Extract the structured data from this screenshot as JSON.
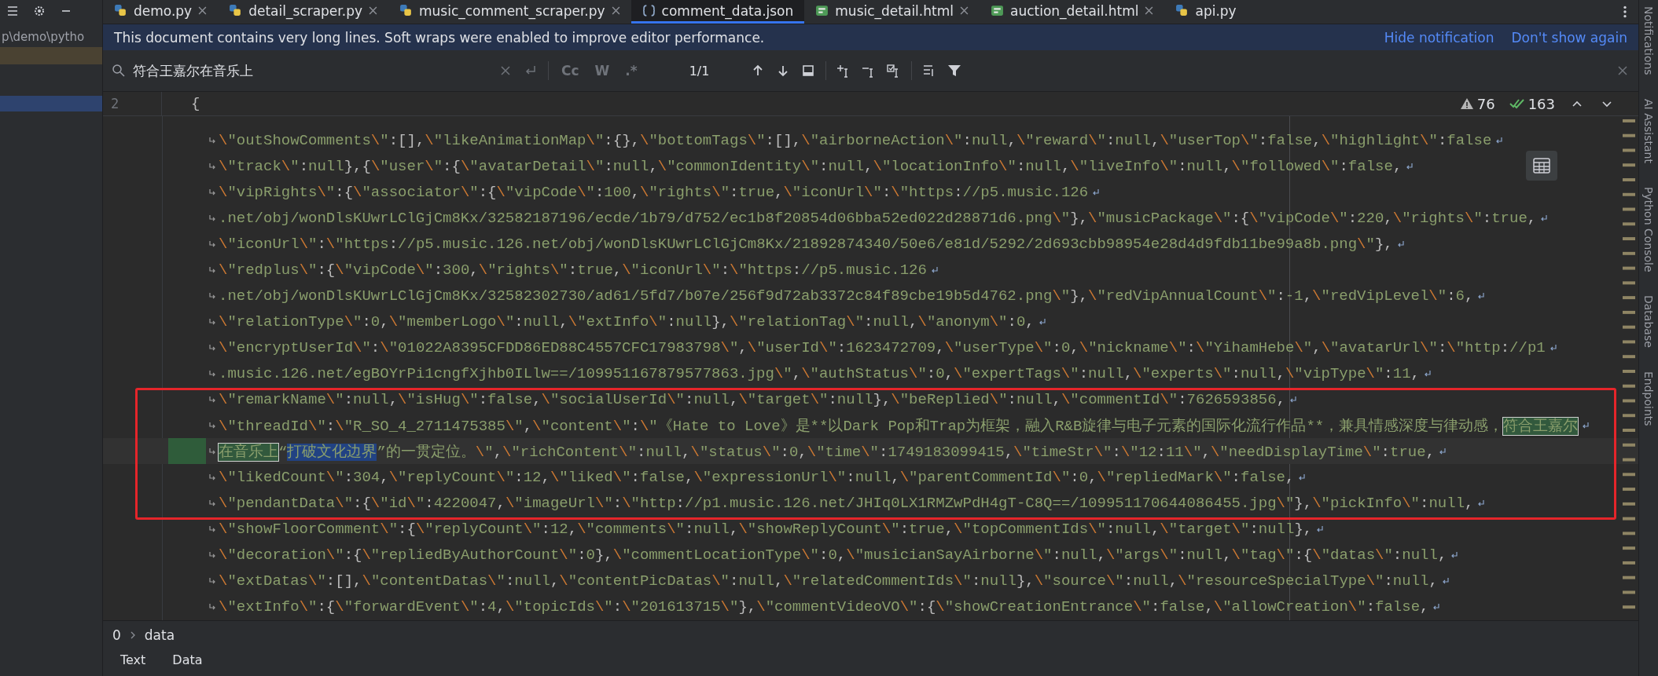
{
  "project_panel": {
    "path": "p\\demo\\pytho"
  },
  "tabs": [
    {
      "label": "demo.py",
      "kind": "py",
      "selected": false,
      "closable": true
    },
    {
      "label": "detail_scraper.py",
      "kind": "py",
      "selected": false,
      "closable": true
    },
    {
      "label": "music_comment_scraper.py",
      "kind": "py",
      "selected": false,
      "closable": true
    },
    {
      "label": "comment_data.json",
      "kind": "json",
      "selected": true,
      "closable": false
    },
    {
      "label": "music_detail.html",
      "kind": "html",
      "selected": false,
      "closable": true
    },
    {
      "label": "auction_detail.html",
      "kind": "html",
      "selected": false,
      "closable": true
    },
    {
      "label": "api.py",
      "kind": "py",
      "selected": false,
      "closable": false
    }
  ],
  "notification": {
    "text": "This document contains very long lines. Soft wraps were enabled to improve editor performance.",
    "actions": [
      "Hide notification",
      "Don't show again"
    ]
  },
  "search": {
    "value": "符合王嘉尔在音乐上",
    "options": [
      "Cc",
      "W",
      ".*"
    ],
    "match_count": "1/1"
  },
  "editor": {
    "header_line_number": "2",
    "header_text": "{",
    "warnings": "76",
    "checks": "163",
    "lines": [
      {
        "current": false,
        "text": "\\\"outShowComments\\\":[],\\\"likeAnimationMap\\\":{},\\\"bottomTags\\\":[],\\\"airborneAction\\\":null,\\\"reward\\\":null,\\\"userTop\\\":false,\\\"highlight\\\":false"
      },
      {
        "current": false,
        "text": "\\\"track\\\":null},{\\\"user\\\":{\\\"avatarDetail\\\":null,\\\"commonIdentity\\\":null,\\\"locationInfo\\\":null,\\\"liveInfo\\\":null,\\\"followed\\\":false,"
      },
      {
        "current": false,
        "text": "\\\"vipRights\\\":{\\\"associator\\\":{\\\"vipCode\\\":100,\\\"rights\\\":true,\\\"iconUrl\\\":\\\"https://p5.music.126"
      },
      {
        "current": false,
        "text": ".net/obj/wonDlsKUwrLClGjCm8Kx/32582187196/ecde/1b79/d752/ec1b8f20854d06bba52ed022d28871d6.png\\\"},\\\"musicPackage\\\":{\\\"vipCode\\\":220,\\\"rights\\\":true,"
      },
      {
        "current": false,
        "text": "\\\"iconUrl\\\":\\\"https://p5.music.126.net/obj/wonDlsKUwrLClGjCm8Kx/21892874340/50e6/e81d/5292/2d693cbb98954e28d4d9fdb11be99a8b.png\\\"},"
      },
      {
        "current": false,
        "text": "\\\"redplus\\\":{\\\"vipCode\\\":300,\\\"rights\\\":true,\\\"iconUrl\\\":\\\"https://p5.music.126"
      },
      {
        "current": false,
        "text": ".net/obj/wonDlsKUwrLClGjCm8Kx/32582302730/ad61/5fd7/b07e/256f9d72ab3372c84f89cbe19b5d4762.png\\\"},\\\"redVipAnnualCount\\\":-1,\\\"redVipLevel\\\":6,"
      },
      {
        "current": false,
        "text": "\\\"relationType\\\":0,\\\"memberLogo\\\":null,\\\"extInfo\\\":null},\\\"relationTag\\\":null,\\\"anonym\\\":0,"
      },
      {
        "current": false,
        "text": "\\\"encryptUserId\\\":\\\"01022A8395CFDD86ED88C4557CFC17983798\\\",\\\"userId\\\":1623472709,\\\"userType\\\":0,\\\"nickname\\\":\\\"YihamHebe\\\",\\\"avatarUrl\\\":\\\"http://p1"
      },
      {
        "current": false,
        "text": ".music.126.net/egBOYrPi1cngfXjhb0ILlw==/109951167879577863.jpg\\\",\\\"authStatus\\\":0,\\\"expertTags\\\":null,\\\"experts\\\":null,\\\"vipType\\\":11,"
      },
      {
        "current": false,
        "text": "\\\"remarkName\\\":null,\\\"isHug\\\":false,\\\"socialUserId\\\":null,\\\"target\\\":null},\\\"beReplied\\\":null,\\\"commentId\\\":7626593856,"
      },
      {
        "current": false,
        "segments": [
          {
            "kind": "code",
            "text": "\\\"threadId\\\":\\\"R_SO_4_2711475385\\\",\\\"content\\\":\\\"《Hate to Love》是**以Dark Pop和Trap为框架，融入R&B旋律与电子元素的国际化流行作品**，兼具情感深度与律动感，"
          },
          {
            "kind": "match",
            "text": "符合王嘉尔"
          }
        ]
      },
      {
        "current": true,
        "segments": [
          {
            "kind": "match",
            "text": "在音乐上"
          },
          {
            "kind": "code",
            "text": "“"
          },
          {
            "kind": "selection",
            "text": "打破文化边界"
          },
          {
            "kind": "code",
            "text": "”的一贯定位。\\\",\\\"richContent\\\":null,\\\"status\\\":0,\\\"time\\\":1749183099415,\\\"timeStr\\\":\\\"12:11\\\",\\\"needDisplayTime\\\":true,"
          }
        ]
      },
      {
        "current": false,
        "text": "\\\"likedCount\\\":304,\\\"replyCount\\\":12,\\\"liked\\\":false,\\\"expressionUrl\\\":null,\\\"parentCommentId\\\":0,\\\"repliedMark\\\":false,"
      },
      {
        "current": false,
        "text": "\\\"pendantData\\\":{\\\"id\\\":4220047,\\\"imageUrl\\\":\\\"http://p1.music.126.net/JHIq0LX1RMZwPdH4gT-C8Q==/109951170644086455.jpg\\\"},\\\"pickInfo\\\":null,"
      },
      {
        "current": false,
        "text": "\\\"showFloorComment\\\":{\\\"replyCount\\\":12,\\\"comments\\\":null,\\\"showReplyCount\\\":true,\\\"topCommentIds\\\":null,\\\"target\\\":null},"
      },
      {
        "current": false,
        "text": "\\\"decoration\\\":{\\\"repliedByAuthorCount\\\":0},\\\"commentLocationType\\\":0,\\\"musicianSayAirborne\\\":null,\\\"args\\\":null,\\\"tag\\\":{\\\"datas\\\":null,"
      },
      {
        "current": false,
        "text": "\\\"extDatas\\\":[],\\\"contentDatas\\\":null,\\\"contentPicDatas\\\":null,\\\"relatedCommentIds\\\":null},\\\"source\\\":null,\\\"resourceSpecialType\\\":null,"
      },
      {
        "current": false,
        "text": "\\\"extInfo\\\":{\\\"forwardEvent\\\":4,\\\"topicIds\\\":\\\"201613715\\\"},\\\"commentVideoVO\\\":{\\\"showCreationEntrance\\\":false,\\\"allowCreation\\\":false,"
      }
    ]
  },
  "breadcrumb": [
    "0",
    "data"
  ],
  "bottom_tabs": [
    "Text",
    "Data"
  ],
  "tool_windows": [
    "Notifications",
    "AI Assistant",
    "Python Console",
    "Database",
    "Endpoints"
  ]
}
